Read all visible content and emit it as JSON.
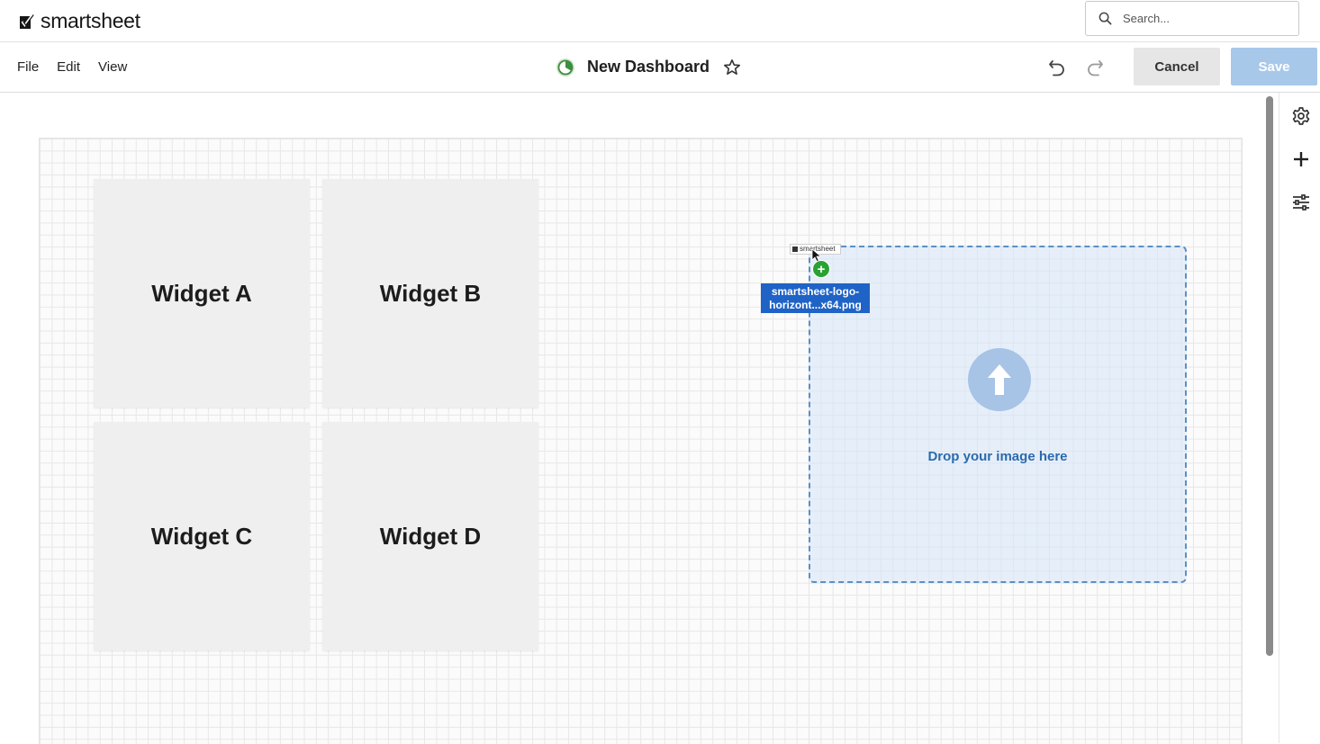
{
  "brand": {
    "name": "smartsheet"
  },
  "search": {
    "placeholder": "Search..."
  },
  "menu": {
    "file": "File",
    "edit": "Edit",
    "view": "View"
  },
  "dashboard": {
    "title": "New Dashboard"
  },
  "actions": {
    "cancel": "Cancel",
    "save": "Save"
  },
  "widgets": [
    {
      "label": "Widget A"
    },
    {
      "label": "Widget B"
    },
    {
      "label": "Widget C"
    },
    {
      "label": "Widget D"
    }
  ],
  "dropzone": {
    "label": "Drop your image here"
  },
  "drag": {
    "thumbnail_text": "smartsheet",
    "file_name_line1": "smartsheet-logo-",
    "file_name_line2": "horizont...x64.png"
  },
  "colors": {
    "save_disabled": "#a8c8ea",
    "dropzone_border": "#5b8fc6",
    "drop_text": "#2b6aad",
    "file_label": "#1f63c6",
    "add_badge": "#2aa233",
    "dashboard_icon": "#3b8f3f"
  },
  "icons": [
    "search-icon",
    "dashboard-icon",
    "star-icon",
    "undo-icon",
    "redo-icon",
    "upload-arrow-icon",
    "plus-icon",
    "gear-icon",
    "sliders-icon",
    "cursor-icon"
  ]
}
